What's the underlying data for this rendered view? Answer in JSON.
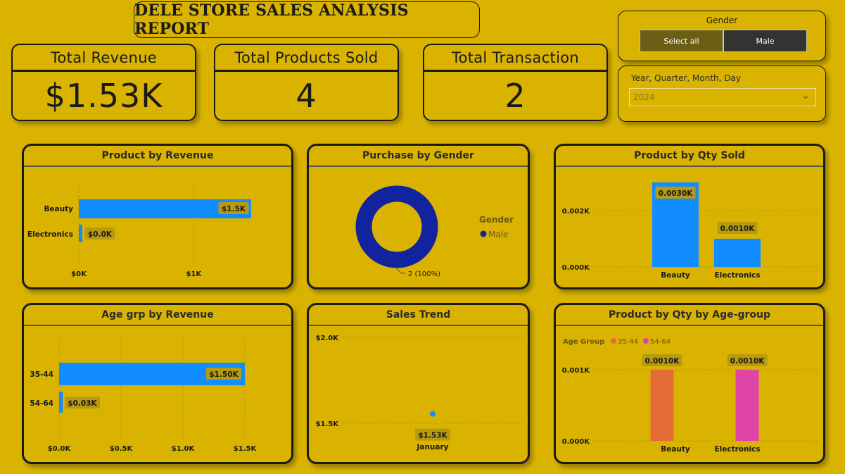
{
  "report_title": "DELE STORE SALES ANALYSIS REPORT",
  "kpis": [
    {
      "label": "Total Revenue",
      "value": "$1.53K"
    },
    {
      "label": "Total Products Sold",
      "value": "4"
    },
    {
      "label": "Total Transaction",
      "value": "2"
    }
  ],
  "slicers": {
    "gender": {
      "title": "Gender",
      "options": [
        "Select all",
        "Male"
      ]
    },
    "date": {
      "title": "Year, Quarter, Month, Day",
      "value": "2024"
    }
  },
  "colors": {
    "background": "#d9b300",
    "bar_blue": "#118dff",
    "donut_navy": "#12239e",
    "age_35_44": "#e66c37",
    "age_54_64": "#e044a7",
    "label_bg": "#b89a10"
  },
  "chart_data": [
    {
      "type": "bar",
      "orientation": "horizontal",
      "title": "Product by Revenue",
      "categories": [
        "Beauty",
        "Electronics"
      ],
      "values": [
        1500,
        30
      ],
      "data_labels": [
        "$1.5K",
        "$0.0K"
      ],
      "x_ticks": [
        "$0K",
        "$1K"
      ],
      "xlim": [
        0,
        1500
      ]
    },
    {
      "type": "pie",
      "variant": "donut",
      "title": "Purchase by Gender",
      "legend_title": "Gender",
      "categories": [
        "Male"
      ],
      "values": [
        2
      ],
      "data_labels": [
        "2 (100%)"
      ],
      "legend": "right"
    },
    {
      "type": "bar",
      "orientation": "vertical",
      "title": "Product by Qty Sold",
      "categories": [
        "Beauty",
        "Electronics"
      ],
      "values": [
        0.003,
        0.001
      ],
      "data_labels": [
        "0.0030K",
        "0.0010K"
      ],
      "y_ticks": [
        "0.000K",
        "0.002K"
      ],
      "ylim": [
        0,
        0.0033
      ]
    },
    {
      "type": "bar",
      "orientation": "horizontal",
      "title": "Age grp by Revenue",
      "categories": [
        "35-44",
        "54-64"
      ],
      "values": [
        1500,
        30
      ],
      "data_labels": [
        "$1.50K",
        "$0.03K"
      ],
      "x_ticks": [
        "$0.0K",
        "$0.5K",
        "$1.0K",
        "$1.5K"
      ],
      "xlim": [
        0,
        1500
      ]
    },
    {
      "type": "line",
      "title": "Sales Trend",
      "categories": [
        "January"
      ],
      "values": [
        1530
      ],
      "data_labels": [
        "$1.53K"
      ],
      "y_ticks": [
        "$1.5K",
        "$2.0K"
      ],
      "ylim": [
        1450,
        2000
      ]
    },
    {
      "type": "bar",
      "orientation": "vertical",
      "title": "Product by Qty by Age-group",
      "legend_title": "Age Group",
      "categories": [
        "Beauty",
        "Electronics"
      ],
      "series": [
        {
          "name": "35-44",
          "values": [
            0.001,
            0
          ]
        },
        {
          "name": "54-64",
          "values": [
            0,
            0.001
          ]
        }
      ],
      "data_labels": [
        "0.0010K",
        "0.0010K"
      ],
      "y_ticks": [
        "0.000K",
        "0.001K"
      ],
      "ylim": [
        0,
        0.001
      ],
      "legend": "top-left"
    }
  ]
}
